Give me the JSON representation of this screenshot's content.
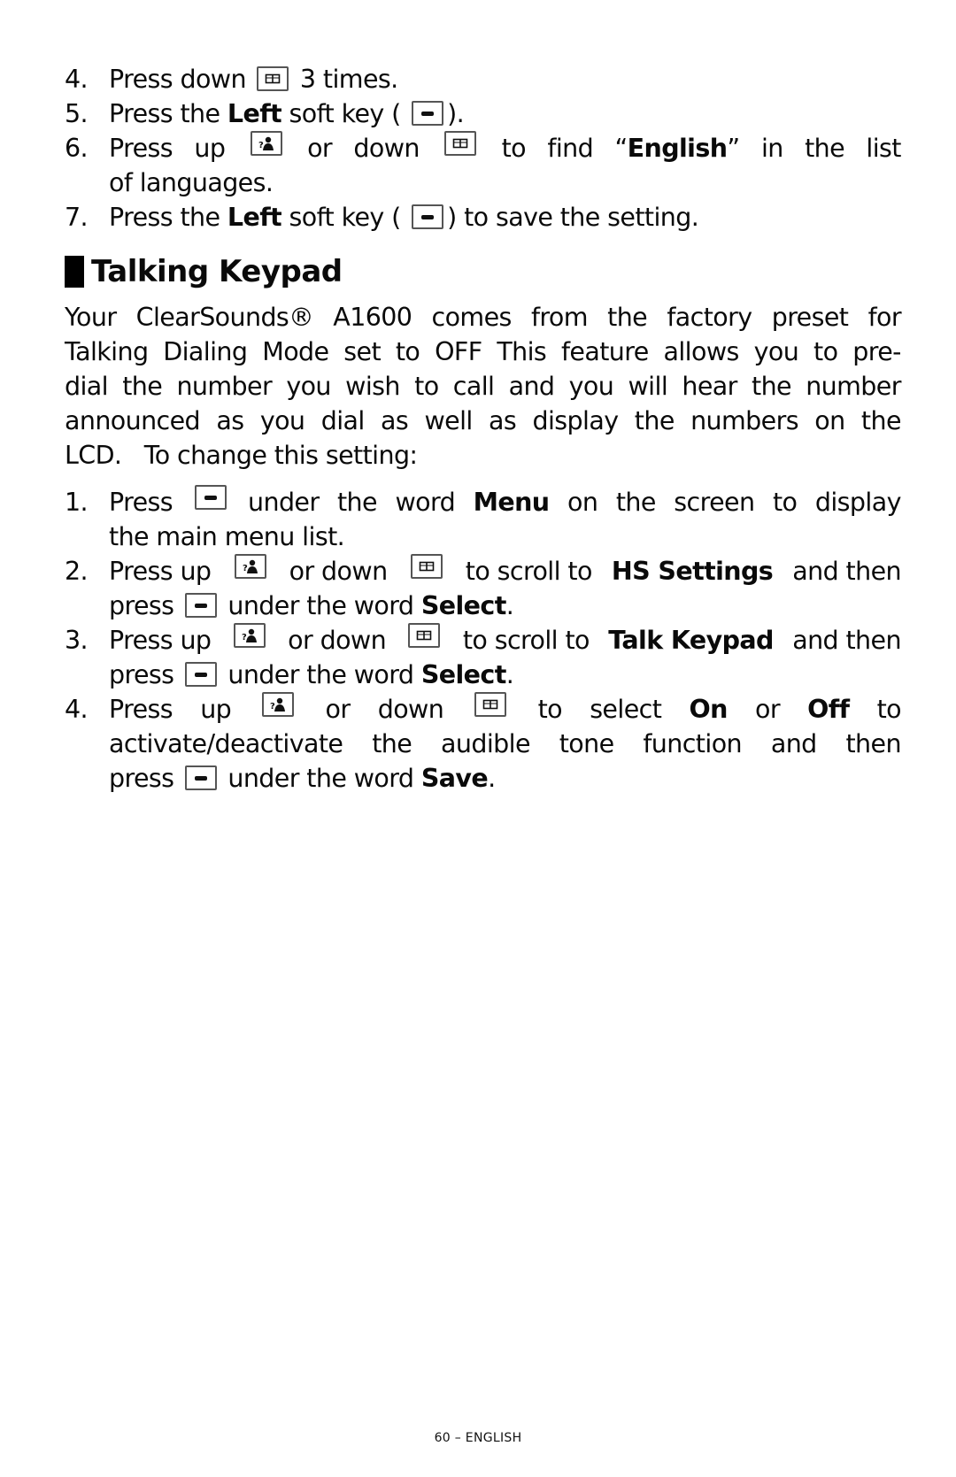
{
  "continued_steps": [
    {
      "num": "4.",
      "parts": [
        "Press down",
        "key:down",
        "3 times."
      ]
    },
    {
      "num": "5.",
      "parts": [
        "Press the",
        "b:Left",
        "soft key (",
        "key:soft",
        ")."
      ]
    },
    {
      "num": "6.",
      "lines": [
        [
          "Press",
          "up",
          "key:up",
          "or",
          "down",
          "key:down",
          "to",
          "find",
          "“b:English”",
          "in",
          "the",
          "list"
        ],
        [
          "of languages."
        ]
      ]
    },
    {
      "num": "7.",
      "parts": [
        "Press the",
        "b:Left",
        "soft key (",
        "key:soft",
        ") to save the setting."
      ]
    }
  ],
  "section": {
    "title": "Talking Keypad",
    "intro_lines": [
      "Your ClearSounds® A1600 comes from the factory preset for",
      "Talking Dialing Mode set to OFF  This feature allows you to pre-",
      "dial the number you wish to call and you will hear the number",
      "announced as you dial as well as display the numbers on the",
      "LCD.   To change this setting:"
    ]
  },
  "steps": {
    "s1_num": "1.",
    "s1_l1": [
      "Press",
      "key:soft",
      "under",
      "the",
      "word",
      "b:Menu",
      "on",
      "the",
      "screen",
      "to",
      "display"
    ],
    "s1_l2": "the main menu list.",
    "s2_num": "2.",
    "s2_l1": [
      "Press up",
      "key:up",
      "or down",
      "key:down",
      "to scroll to",
      "b:HS Settings",
      "and then"
    ],
    "s2_l2": [
      "press",
      "key:soft",
      "under the word",
      "b:Select",
      "."
    ],
    "s3_num": "3.",
    "s3_l1": [
      "Press up",
      "key:up",
      "or down",
      "key:down",
      "to scroll to",
      "b:Talk Keypad",
      "and then"
    ],
    "s3_l2": [
      "press",
      "key:soft",
      "under the word",
      "b:Select",
      "."
    ],
    "s4_num": "4.",
    "s4_l1": [
      "Press",
      "up",
      "key:up",
      "or",
      "down",
      "key:down",
      "to",
      "select",
      "b:On",
      "or",
      "b:Off",
      "to"
    ],
    "s4_l2": [
      "activate/deactivate",
      "the",
      "audible",
      "tone",
      "function",
      "and",
      "then"
    ],
    "s4_l3": [
      "press",
      "key:soft",
      "under the word",
      "b:Save",
      "."
    ]
  },
  "icons": {
    "soft": "soft-key-icon",
    "up": "phonebook-up-icon",
    "down": "book-down-icon"
  },
  "footer": "60 – ENGLISH"
}
